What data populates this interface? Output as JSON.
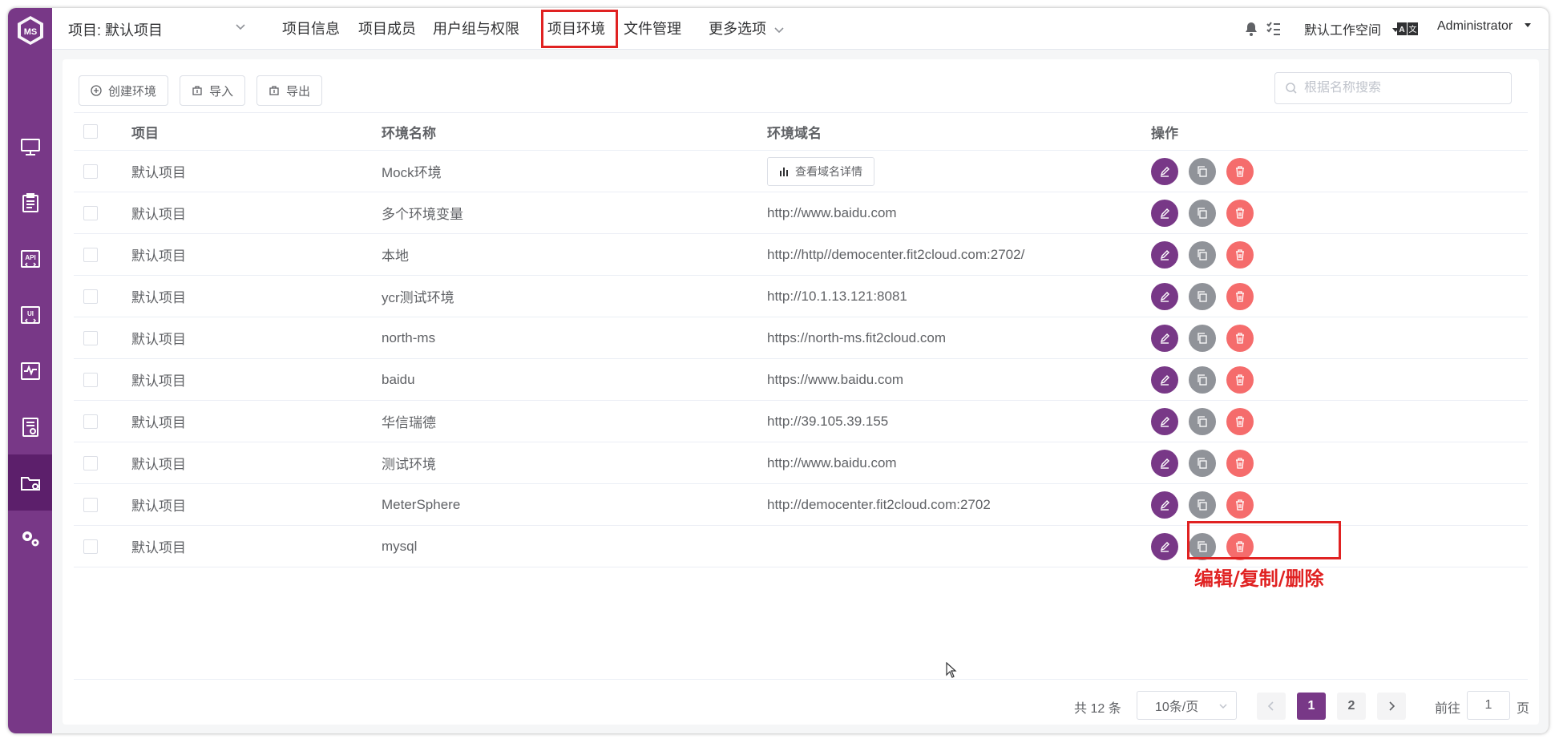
{
  "colors": {
    "brand": "#783887",
    "edit": "#783887",
    "copy": "#909399",
    "delete": "#f56c6c",
    "annotation": "#e02222"
  },
  "sidebar": {
    "logo": "ms-logo-icon",
    "items": [
      {
        "icon": "workstation-icon"
      },
      {
        "icon": "test-track-icon"
      },
      {
        "icon": "api-test-icon"
      },
      {
        "icon": "ui-test-icon"
      },
      {
        "icon": "performance-test-icon"
      },
      {
        "icon": "report-icon"
      },
      {
        "icon": "project-settings-icon",
        "active": true
      },
      {
        "icon": "system-settings-icon"
      }
    ]
  },
  "header": {
    "project_select": "项目: 默认项目",
    "nav": [
      "项目信息",
      "项目成员",
      "用户组与权限",
      "项目环境",
      "文件管理",
      "更多选项"
    ],
    "active_nav": "项目环境",
    "workspace": "默认工作空间",
    "user": "Administrator"
  },
  "toolbar": {
    "create_label": "创建环境",
    "import_label": "导入",
    "export_label": "导出",
    "search_placeholder": "根据名称搜索"
  },
  "table": {
    "columns": [
      "项目",
      "环境名称",
      "环境域名",
      "操作"
    ],
    "rows": [
      {
        "project": "默认项目",
        "name": "Mock环境",
        "domain": "",
        "domain_button": "查看域名详情"
      },
      {
        "project": "默认项目",
        "name": "多个环境变量",
        "domain": "http://www.baidu.com"
      },
      {
        "project": "默认项目",
        "name": "本地",
        "domain": "http://http//democenter.fit2cloud.com:2702/"
      },
      {
        "project": "默认项目",
        "name": "ycr测试环境",
        "domain": "http://10.1.13.121:8081"
      },
      {
        "project": "默认项目",
        "name": "north-ms",
        "domain": "https://north-ms.fit2cloud.com"
      },
      {
        "project": "默认项目",
        "name": "baidu",
        "domain": "https://www.baidu.com"
      },
      {
        "project": "默认项目",
        "name": "华信瑞德",
        "domain": "http://39.105.39.155"
      },
      {
        "project": "默认项目",
        "name": "测试环境",
        "domain": "http://www.baidu.com"
      },
      {
        "project": "默认项目",
        "name": "MeterSphere",
        "domain": "http://democenter.fit2cloud.com:2702"
      },
      {
        "project": "默认项目",
        "name": "mysql",
        "domain": ""
      }
    ]
  },
  "annotation": "编辑/复制/删除",
  "pagination": {
    "total": "共 12 条",
    "page_size": "10条/页",
    "pages": [
      "1",
      "2"
    ],
    "current": "1",
    "goto_prefix": "前往",
    "goto_value": "1",
    "goto_suffix": "页"
  }
}
